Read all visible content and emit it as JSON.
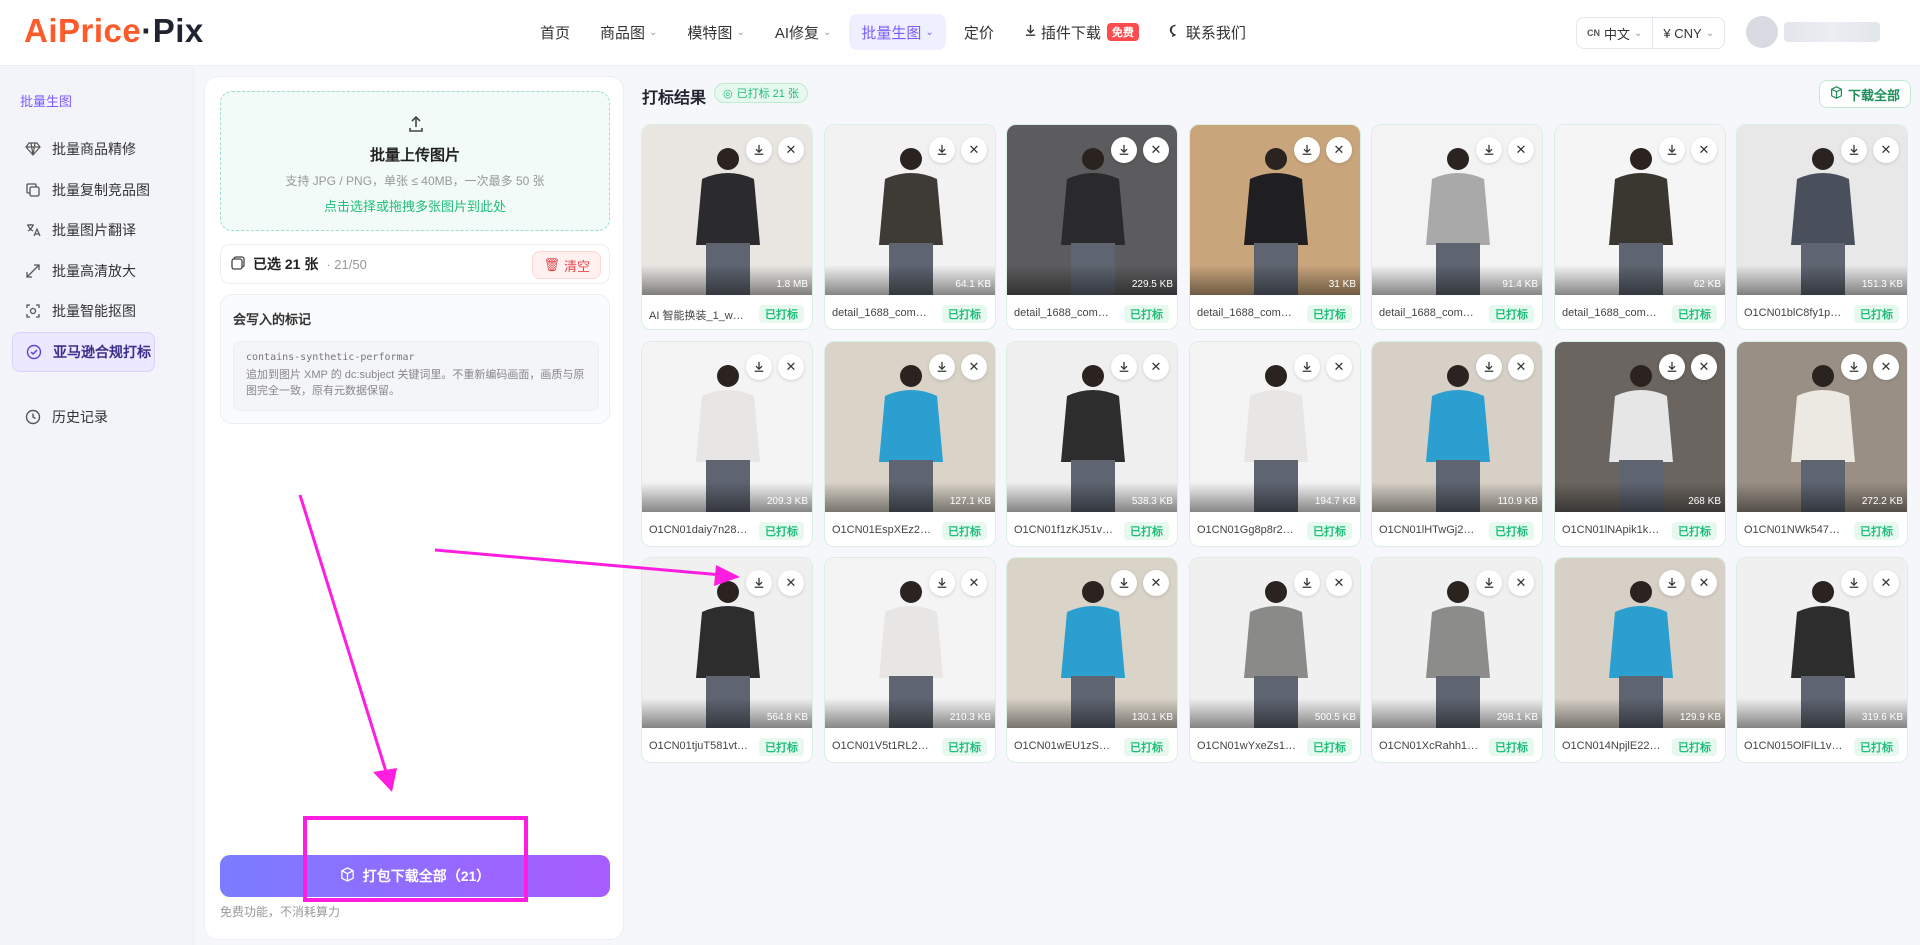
{
  "header": {
    "logo_a": "AiPrice",
    "logo_b": "·Pix",
    "nav": [
      {
        "label": "首页",
        "dropdown": false,
        "active": false
      },
      {
        "label": "商品图",
        "dropdown": true,
        "active": false
      },
      {
        "label": "模特图",
        "dropdown": true,
        "active": false
      },
      {
        "label": "AI修复",
        "dropdown": true,
        "active": false
      },
      {
        "label": "批量生图",
        "dropdown": true,
        "active": true
      },
      {
        "label": "定价",
        "dropdown": false,
        "active": false
      },
      {
        "label": "插件下载",
        "dropdown": false,
        "active": false,
        "badge": "免费"
      },
      {
        "label": "联系我们",
        "dropdown": false,
        "active": false
      }
    ],
    "lang_code": "CN",
    "lang": "中文",
    "currency": "¥ CNY"
  },
  "sidebar": {
    "section_title": "批量生图",
    "items": [
      {
        "label": "批量商品精修",
        "icon": "diamond-icon"
      },
      {
        "label": "批量复制竞品图",
        "icon": "copy-icon"
      },
      {
        "label": "批量图片翻译",
        "icon": "translate-icon"
      },
      {
        "label": "批量高清放大",
        "icon": "expand-icon"
      },
      {
        "label": "批量智能抠图",
        "icon": "cutout-icon"
      },
      {
        "label": "亚马逊合规打标",
        "icon": "check-circle-icon",
        "active": true
      }
    ],
    "history": "历史记录"
  },
  "panel": {
    "upload_title": "批量上传图片",
    "upload_sub": "支持 JPG / PNG，单张 ≤ 40MB，一次最多 50 张",
    "upload_link": "点击选择或拖拽多张图片到此处",
    "selected": "已选 21 张",
    "selected_frac": "· 21/50",
    "clear": "清空",
    "mark_title": "会写入的标记",
    "mark_code": "contains-synthetic-performar",
    "mark_desc": "追加到图片 XMP 的 dc:subject 关键词里。不重新编码画面，画质与原图完全一致，原有元数据保留。",
    "pack_button": "打包下载全部（21）",
    "pack_note": "免费功能，不消耗算力"
  },
  "results": {
    "title": "打标结果",
    "badge": "已打标 21 张",
    "download_all": "下载全部",
    "tag_label": "已打标",
    "items": [
      {
        "name": "AI 智能换装_1_wat...",
        "size": "1.8 MB",
        "bg": "#e9e6e2",
        "fig": "#2b2b2d"
      },
      {
        "name": "detail_1688_com_1...",
        "size": "64.1 KB",
        "bg": "#f2f2f2",
        "fig": "#3e3a36"
      },
      {
        "name": "detail_1688_com_1...",
        "size": "229.5 KB",
        "bg": "#5c5c5e",
        "fig": "#2a2a2c"
      },
      {
        "name": "detail_1688_com_1...",
        "size": "31 KB",
        "bg": "#c9a57c",
        "fig": "#1f1f21"
      },
      {
        "name": "detail_1688_com_1...",
        "size": "91.4 KB",
        "bg": "#f3f3f3",
        "fig": "#a9a9a9"
      },
      {
        "name": "detail_1688_com_1...",
        "size": "62 KB",
        "bg": "#f5f5f5",
        "fig": "#3a3630"
      },
      {
        "name": "O1CN01blC8fy1py4...",
        "size": "151.3 KB",
        "bg": "#e8e8e8",
        "fig": "#4a4f5c"
      },
      {
        "name": "O1CN01daiy7n28W...",
        "size": "209.3 KB",
        "bg": "#f4f4f4",
        "fig": "#e8e6e4"
      },
      {
        "name": "O1CN01EspXEz22Y...",
        "size": "127.1 KB",
        "bg": "#d9d3c8",
        "fig": "#2a9fd0"
      },
      {
        "name": "O1CN01f1zKJ51vtr0...",
        "size": "538.3 KB",
        "bg": "#efefef",
        "fig": "#2d2d2d"
      },
      {
        "name": "O1CN01Gg8p8r28...",
        "size": "194.7 KB",
        "bg": "#f4f4f4",
        "fig": "#e8e6e4"
      },
      {
        "name": "O1CN01lHTwGj22Y3...",
        "size": "110.9 KB",
        "bg": "#d6d0c6",
        "fig": "#2a9fd0"
      },
      {
        "name": "O1CN01lNApik1kqg...",
        "size": "268 KB",
        "bg": "#6a6560",
        "fig": "#e6e6e6"
      },
      {
        "name": "O1CN01NWk5471S7...",
        "size": "272.2 KB",
        "bg": "#9a8f85",
        "fig": "#ece8e2"
      },
      {
        "name": "O1CN01tjuT581vtr0...",
        "size": "564.8 KB",
        "bg": "#f0f0f0",
        "fig": "#2d2d2d"
      },
      {
        "name": "O1CN01V5t1RL28W...",
        "size": "210.3 KB",
        "bg": "#f4f4f4",
        "fig": "#e8e6e4"
      },
      {
        "name": "O1CN01wEU1zS22Y...",
        "size": "130.1 KB",
        "bg": "#d9d3c8",
        "fig": "#2a9fd0"
      },
      {
        "name": "O1CN01wYxeZs1vtr...",
        "size": "500.5 KB",
        "bg": "#f0f0f0",
        "fig": "#8a8a88"
      },
      {
        "name": "O1CN01XcRahh1vtr...",
        "size": "298.1 KB",
        "bg": "#f0f0f0",
        "fig": "#8c8c8a"
      },
      {
        "name": "O1CN014NpjlE22Y3...",
        "size": "129.9 KB",
        "bg": "#d6d0c6",
        "fig": "#2a9fd0"
      },
      {
        "name": "O1CN015OlFIL1vtr0...",
        "size": "319.6 KB",
        "bg": "#f0f0f0",
        "fig": "#2d2d2d"
      }
    ]
  },
  "annotation_color": "#ff1ee0"
}
